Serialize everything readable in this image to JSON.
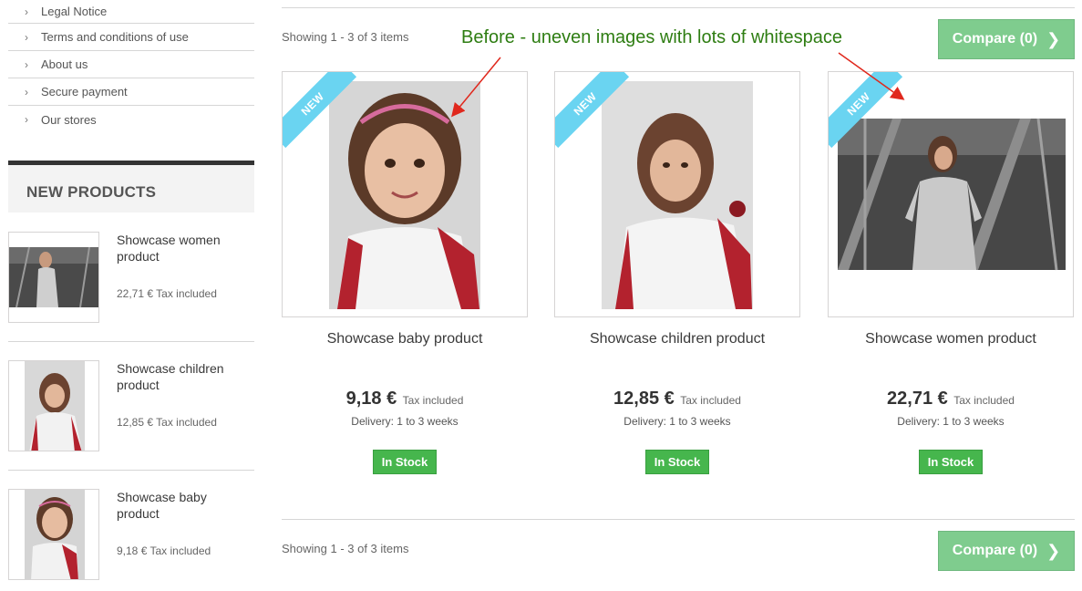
{
  "sidebar": {
    "info_links": [
      {
        "label": "Legal Notice"
      },
      {
        "label": "Terms and conditions of use"
      },
      {
        "label": "About us"
      },
      {
        "label": "Secure payment"
      },
      {
        "label": "Our stores"
      }
    ],
    "new_products_title": "NEW PRODUCTS",
    "products": [
      {
        "name": "Showcase women product",
        "price": "22,71 € Tax included"
      },
      {
        "name": "Showcase children product",
        "price": "12,85 € Tax included"
      },
      {
        "name": "Showcase baby product",
        "price": "9,18 € Tax included"
      }
    ]
  },
  "listing": {
    "showing_top": "Showing 1 - 3 of 3 items",
    "showing_bottom": "Showing 1 - 3 of 3 items",
    "compare_label": "Compare (0)",
    "annotation": "Before - uneven images with lots of whitespace",
    "products": [
      {
        "badge": "NEW",
        "name": "Showcase baby product",
        "price": "9,18 €",
        "tax": "Tax included",
        "delivery": "Delivery: 1 to 3 weeks",
        "stock": "In Stock"
      },
      {
        "badge": "NEW",
        "name": "Showcase children product",
        "price": "12,85 €",
        "tax": "Tax included",
        "delivery": "Delivery: 1 to 3 weeks",
        "stock": "In Stock"
      },
      {
        "badge": "NEW",
        "name": "Showcase women product",
        "price": "22,71 €",
        "tax": "Tax included",
        "delivery": "Delivery: 1 to 3 weeks",
        "stock": "In Stock"
      }
    ]
  },
  "colors": {
    "compare_bg": "#7fcc8e",
    "stock_bg": "#46b64d",
    "ribbon_bg": "#6ad4f1",
    "annotation": "#2e7d12",
    "arrow": "#e0281d"
  },
  "icons": {
    "chevron": "chevron-right-icon",
    "compare_arrow": "chevron-right-icon"
  }
}
